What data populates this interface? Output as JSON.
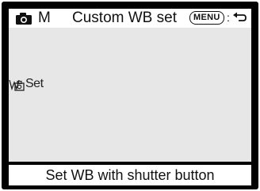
{
  "topbar": {
    "camera_icon": "camera-icon",
    "mode": "M",
    "title": "Custom WB set",
    "menu_badge": "MENU",
    "menu_separator": ":",
    "back_icon": "return-arrow-icon"
  },
  "main": {
    "wb_icon": "custom-wb-icon",
    "wb_set_label": "Set"
  },
  "footer": {
    "hint": "Set WB with shutter button"
  },
  "colors": {
    "frame": "#000000",
    "bar_background": "#ffffff",
    "area_background": "#e7e7e7",
    "text": "#111111"
  }
}
